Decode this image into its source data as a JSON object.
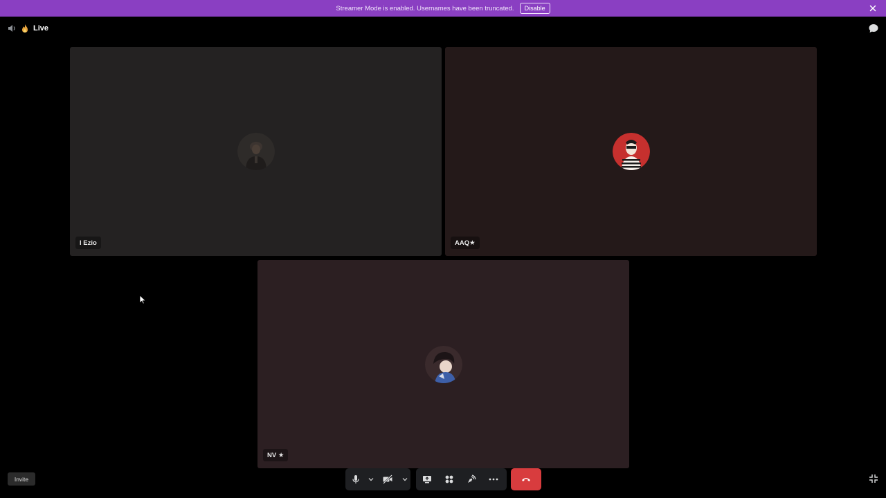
{
  "banner": {
    "message": "Streamer Mode is enabled. Usernames have been truncated.",
    "disable_label": "Disable",
    "color": "#8a3fc2"
  },
  "header": {
    "channel_label": "Live",
    "channel_icon": "fire-icon",
    "voice_icon": "speaker-icon",
    "chat_icon": "chat-bubble-icon"
  },
  "participants": [
    {
      "name": "I Ezio",
      "tile_color": "#242222",
      "avatar": "user-avatar-ezio"
    },
    {
      "name": "AAQ★",
      "tile_color": "#241919",
      "avatar": "user-avatar-aaq"
    },
    {
      "name": "NV ★",
      "tile_color": "#2c1f22",
      "avatar": "user-avatar-nv"
    }
  ],
  "footer": {
    "invite_label": "Invite",
    "controls": [
      "microphone-icon",
      "chevron-down-icon",
      "camera-off-icon",
      "chevron-down-icon",
      "screen-share-icon",
      "activities-icon",
      "soundboard-icon",
      "more-icon"
    ],
    "hangup_icon": "phone-hangup-icon",
    "hangup_color": "#d83c3e",
    "fullscreen_icon": "collapse-icon"
  }
}
